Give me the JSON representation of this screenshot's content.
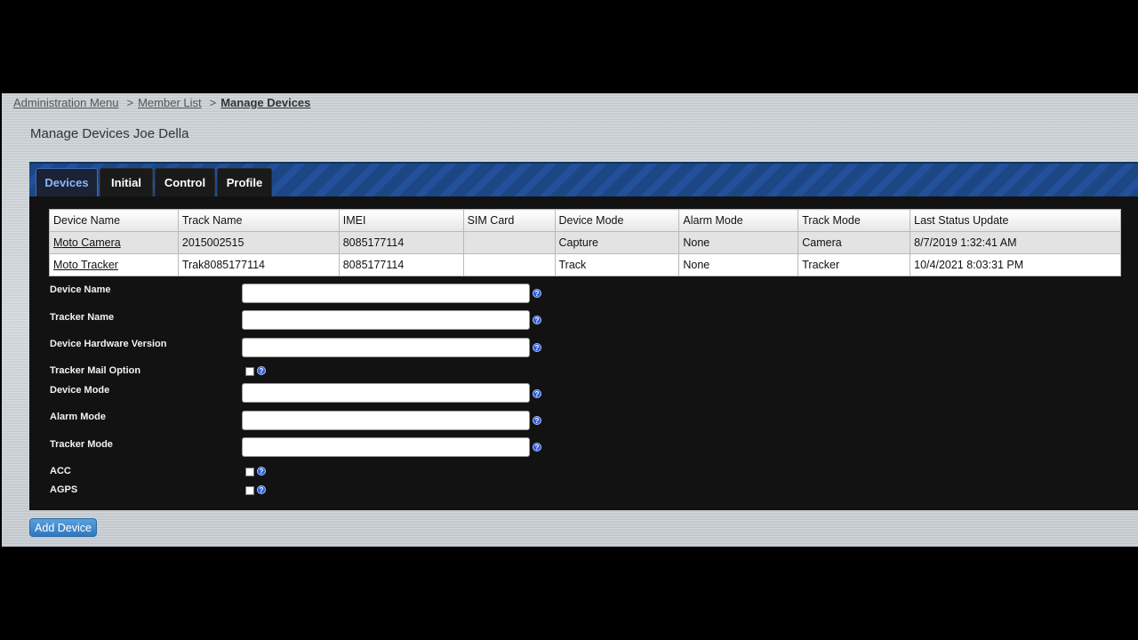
{
  "breadcrumb": {
    "items": [
      "Administration Menu",
      "Member List",
      "Manage Devices"
    ],
    "separator": ">"
  },
  "page_title": "Manage Devices Joe Della",
  "tabs": [
    "Devices",
    "Initial",
    "Control",
    "Profile"
  ],
  "table": {
    "headers": [
      "Device Name",
      "Track Name",
      "IMEI",
      "SIM Card",
      "Device Mode",
      "Alarm Mode",
      "Track Mode",
      "Last Status Update"
    ],
    "rows": [
      [
        "Moto Camera",
        "2015002515",
        "8085177114",
        "",
        "Capture",
        "None",
        "Camera",
        "8/7/2019 1:32:41 AM"
      ],
      [
        "Moto Tracker",
        "Trak8085177114",
        "8085177114",
        "",
        "Track",
        "None",
        "Tracker",
        "10/4/2021 8:03:31 PM"
      ]
    ]
  },
  "form": {
    "device_name": "Device Name",
    "tracker_name": "Tracker Name",
    "hardware_version": "Device Hardware Version",
    "tracker_mail_option": "Tracker Mail Option",
    "device_mode": "Device Mode",
    "alarm_mode": "Alarm Mode",
    "tracker_mode": "Tracker Mode",
    "acc": "ACC",
    "agps": "AGPS",
    "help_glyph": "?"
  },
  "add_device_label": "Add Device",
  "colors": {
    "tab_active_text": "#8fb4ff",
    "tabbar_blue": "#1d4784",
    "button_blue": "#2f78bf",
    "help_blue": "#2f5bd6"
  }
}
